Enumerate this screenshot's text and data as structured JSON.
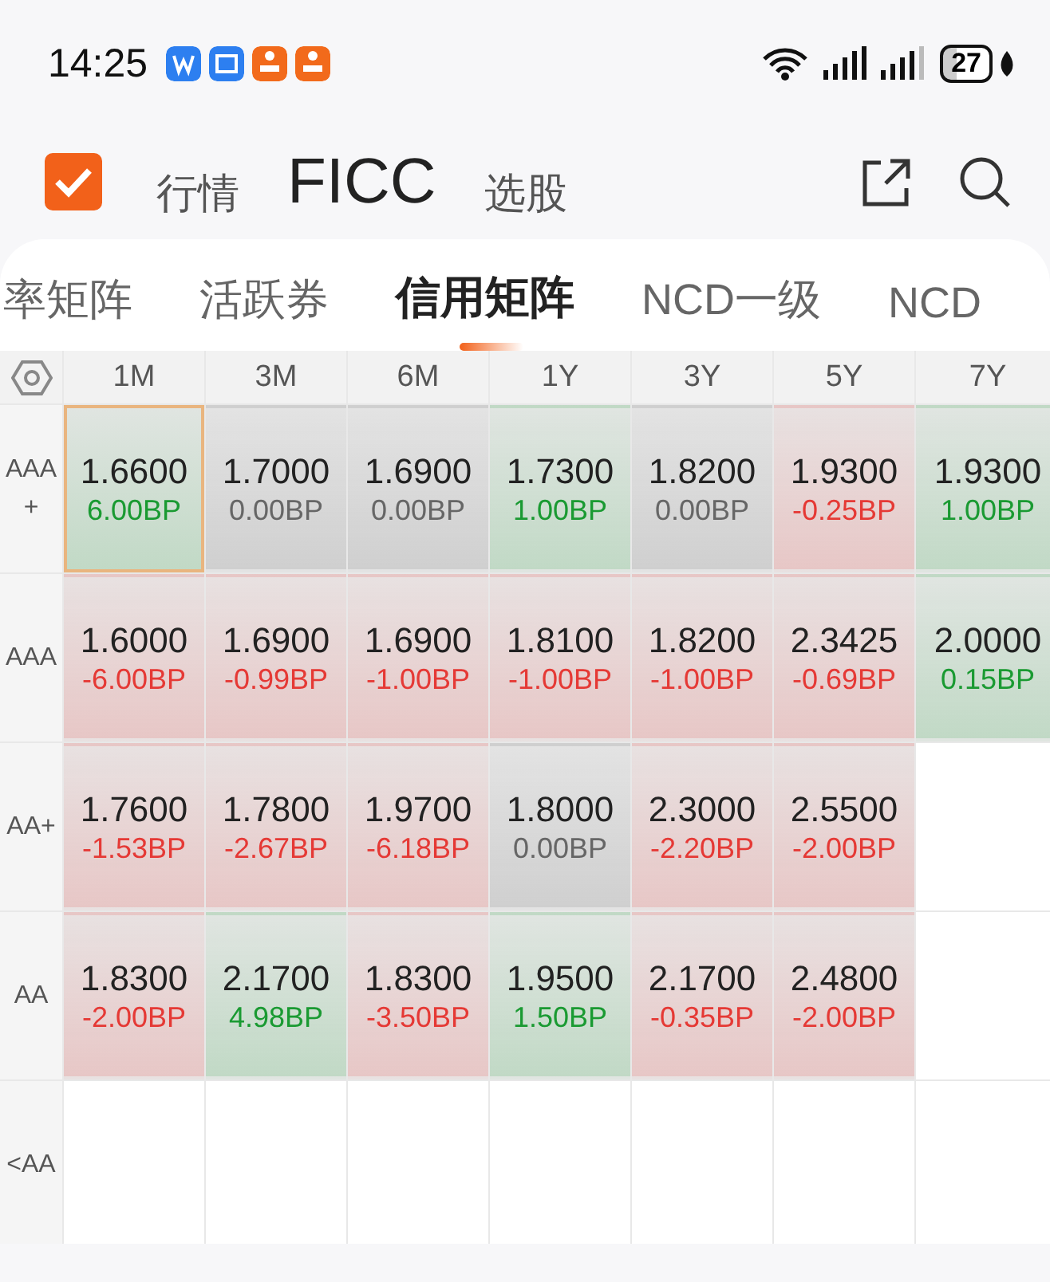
{
  "status_bar": {
    "time": "14:25",
    "battery": "27"
  },
  "header": {
    "nav": [
      {
        "label": "行情",
        "selected": false
      },
      {
        "label": "FICC",
        "selected": true
      },
      {
        "label": "选股",
        "selected": false
      }
    ]
  },
  "tabs": [
    {
      "label": "率矩阵",
      "selected": false
    },
    {
      "label": "活跃券",
      "selected": false
    },
    {
      "label": "信用矩阵",
      "selected": true
    },
    {
      "label": "NCD一级",
      "selected": false
    },
    {
      "label": "NCD",
      "selected": false
    }
  ],
  "matrix": {
    "columns": [
      "1M",
      "3M",
      "6M",
      "1Y",
      "3Y",
      "5Y",
      "7Y"
    ],
    "rows": [
      {
        "label": "AAA+",
        "cells": [
          {
            "value": "1.6600",
            "change": "6.00BP",
            "color": "#1a9a32",
            "selected": true
          },
          {
            "value": "1.7000",
            "change": "0.00BP",
            "color": "#666666",
            "selected": false
          },
          {
            "value": "1.6900",
            "change": "0.00BP",
            "color": "#666666",
            "selected": false
          },
          {
            "value": "1.7300",
            "change": "1.00BP",
            "color": "#1a9a32",
            "selected": false
          },
          {
            "value": "1.8200",
            "change": "0.00BP",
            "color": "#666666",
            "selected": false
          },
          {
            "value": "1.9300",
            "change": "-0.25BP",
            "color": "#e53935",
            "selected": false
          },
          {
            "value": "1.9300",
            "change": "1.00BP",
            "color": "#1a9a32",
            "selected": false
          }
        ]
      },
      {
        "label": "AAA",
        "cells": [
          {
            "value": "1.6000",
            "change": "-6.00BP",
            "color": "#e53935",
            "selected": false
          },
          {
            "value": "1.6900",
            "change": "-0.99BP",
            "color": "#e53935",
            "selected": false
          },
          {
            "value": "1.6900",
            "change": "-1.00BP",
            "color": "#e53935",
            "selected": false
          },
          {
            "value": "1.8100",
            "change": "-1.00BP",
            "color": "#e53935",
            "selected": false
          },
          {
            "value": "1.8200",
            "change": "-1.00BP",
            "color": "#e53935",
            "selected": false
          },
          {
            "value": "2.3425",
            "change": "-0.69BP",
            "color": "#e53935",
            "selected": false
          },
          {
            "value": "2.0000",
            "change": "0.15BP",
            "color": "#1a9a32",
            "selected": false
          }
        ]
      },
      {
        "label": "AA+",
        "cells": [
          {
            "value": "1.7600",
            "change": "-1.53BP",
            "color": "#e53935",
            "selected": false
          },
          {
            "value": "1.7800",
            "change": "-2.67BP",
            "color": "#e53935",
            "selected": false
          },
          {
            "value": "1.9700",
            "change": "-6.18BP",
            "color": "#e53935",
            "selected": false
          },
          {
            "value": "1.8000",
            "change": "0.00BP",
            "color": "#666666",
            "selected": false
          },
          {
            "value": "2.3000",
            "change": "-2.20BP",
            "color": "#e53935",
            "selected": false
          },
          {
            "value": "2.5500",
            "change": "-2.00BP",
            "color": "#e53935",
            "selected": false
          }
        ]
      },
      {
        "label": "AA",
        "cells": [
          {
            "value": "1.8300",
            "change": "-2.00BP",
            "color": "#e53935",
            "selected": false
          },
          {
            "value": "2.1700",
            "change": "4.98BP",
            "color": "#1a9a32",
            "selected": false
          },
          {
            "value": "1.8300",
            "change": "-3.50BP",
            "color": "#e53935",
            "selected": false
          },
          {
            "value": "1.9500",
            "change": "1.50BP",
            "color": "#1a9a32",
            "selected": false
          },
          {
            "value": "2.1700",
            "change": "-0.35BP",
            "color": "#e53935",
            "selected": false
          },
          {
            "value": "2.4800",
            "change": "-2.00BP",
            "color": "#e53935",
            "selected": false
          }
        ]
      },
      {
        "label": "<AA",
        "cells": []
      }
    ]
  }
}
